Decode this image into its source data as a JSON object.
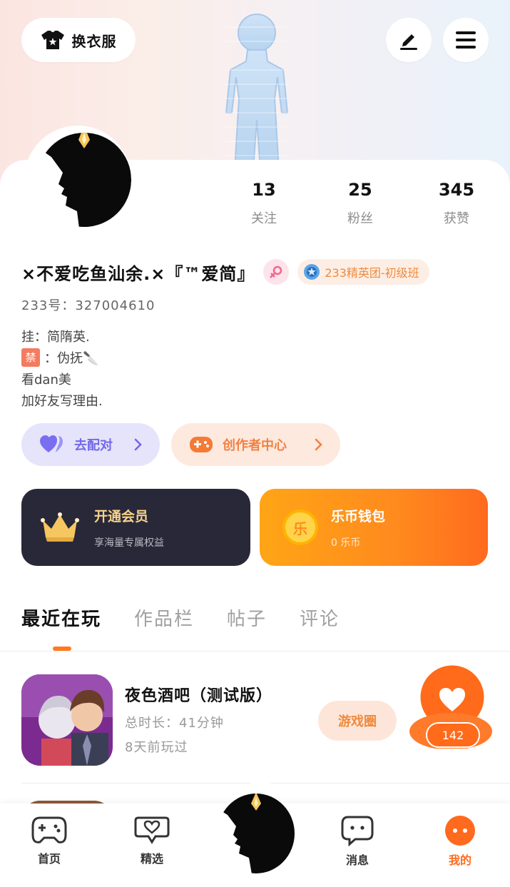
{
  "header": {
    "dress_label": "换衣服",
    "icons": [
      "shirt-icon",
      "edit-icon",
      "menu-icon"
    ]
  },
  "stats": [
    {
      "value": "13",
      "label": "关注"
    },
    {
      "value": "25",
      "label": "粉丝"
    },
    {
      "value": "345",
      "label": "获赞"
    }
  ],
  "profile": {
    "nickname": "×不爱吃鱼汕余.×『™爱简』",
    "club_badge": "233精英团-初级班",
    "uid": "233号：327004610",
    "bio": {
      "line1": "挂：简隋英.",
      "ban_tag": "禁",
      "line2": "：伪抚🔪",
      "line3": "看dan美",
      "line4": "加好友写理由."
    }
  },
  "actions": {
    "pair_label": "去配对",
    "creator_label": "创作者中心"
  },
  "promos": {
    "vip_title": "开通会员",
    "vip_sub": "享海量专属权益",
    "wallet_title": "乐币钱包",
    "wallet_sub": "0 乐币",
    "wallet_coin": "乐"
  },
  "tabs": [
    "最近在玩",
    "作品栏",
    "帖子",
    "评论"
  ],
  "active_tab": "最近在玩",
  "recent_games": [
    {
      "title": "夜色酒吧（测试版）",
      "total_time": "总时长：41分钟",
      "last_played": "8天前玩过",
      "circle_label": "游戏圈",
      "likes": "142"
    }
  ],
  "bottom_nav": [
    {
      "label": "首页",
      "icon": "gamepad-icon"
    },
    {
      "label": "精选",
      "icon": "heart-chat-icon"
    },
    {
      "label": "",
      "icon": "avatar-center-icon"
    },
    {
      "label": "消息",
      "icon": "message-icon"
    },
    {
      "label": "我的",
      "icon": "me-icon",
      "active": true
    }
  ],
  "colors": {
    "accent": "#ff6a1e",
    "pair": "#7369e6",
    "creator": "#f28042",
    "vip_bg": "#282838",
    "vip_text": "#f6d38a"
  }
}
